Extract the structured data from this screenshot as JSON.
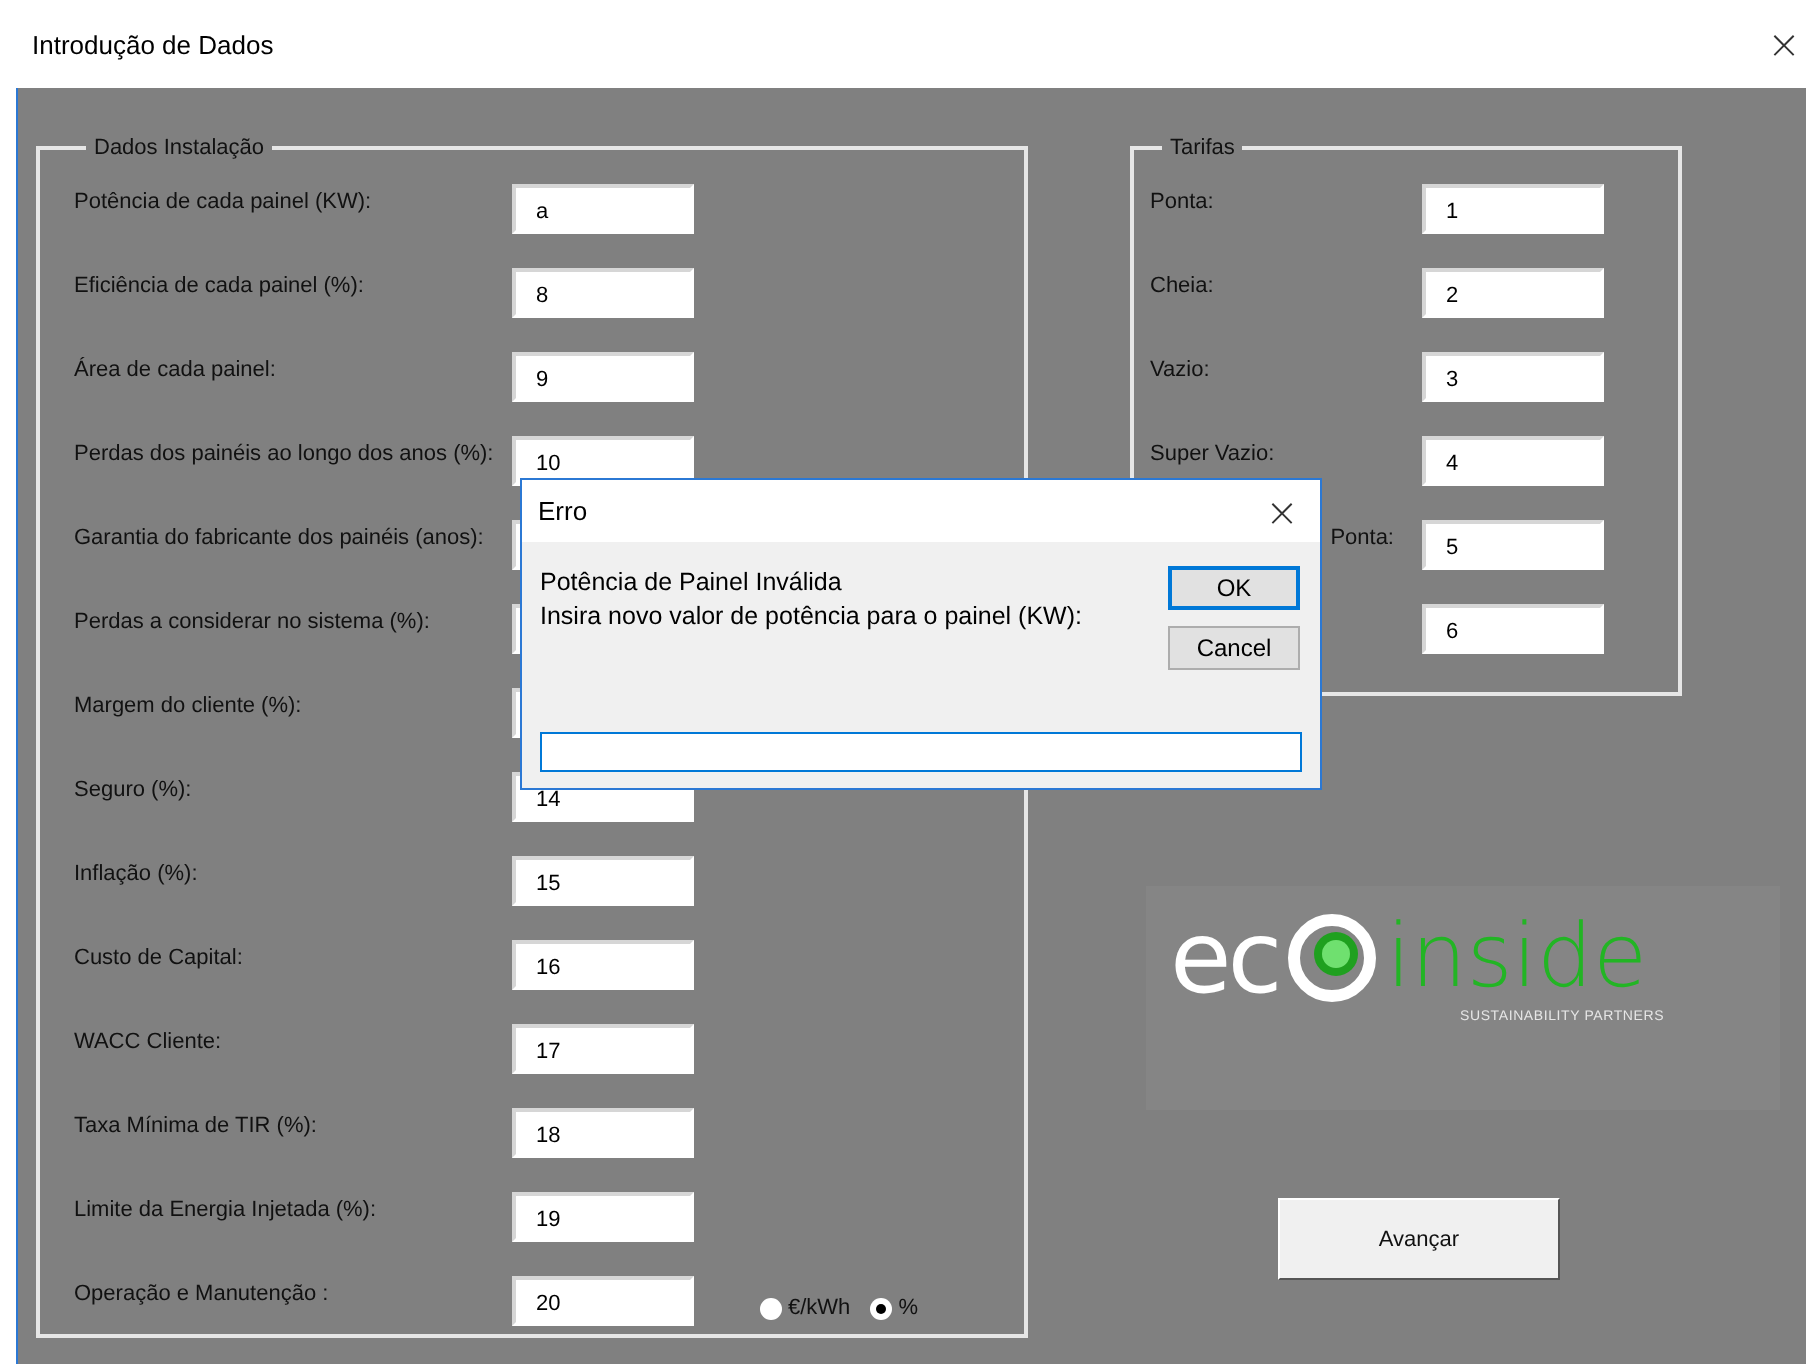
{
  "window": {
    "title": "Introdução de Dados",
    "close": "×"
  },
  "installation": {
    "legend": "Dados Instalação",
    "rows": [
      {
        "label": "Potência de cada painel (KW):",
        "value": "a"
      },
      {
        "label": "Eficiência de cada painel (%):",
        "value": "8"
      },
      {
        "label": "Área de cada painel:",
        "value": "9"
      },
      {
        "label": "Perdas dos painéis ao longo dos anos (%):",
        "value": "10"
      },
      {
        "label": "Garantia do fabricante dos painéis (anos):"
      },
      {
        "label": "Perdas a considerar no sistema (%):"
      },
      {
        "label": "Margem do cliente (%):"
      },
      {
        "label": "Seguro (%):",
        "value": "14"
      },
      {
        "label": "Inflação (%):",
        "value": "15"
      },
      {
        "label": "Custo de Capital:",
        "value": "16"
      },
      {
        "label": "WACC Cliente:",
        "value": "17"
      },
      {
        "label": "Taxa Mínima de TIR (%):",
        "value": "18"
      },
      {
        "label": "Limite da Energia Injetada (%):",
        "value": "19"
      },
      {
        "label": "Operação e Manutenção :",
        "value": "20",
        "units": [
          {
            "label": "€/kWh",
            "selected": false
          },
          {
            "label": "%",
            "selected": true
          }
        ]
      }
    ]
  },
  "tariffs": {
    "legend": "Tarifas",
    "rows": [
      {
        "label": "Ponta:",
        "value": "1"
      },
      {
        "label": "Cheia:",
        "value": "2"
      },
      {
        "label": "Vazio:",
        "value": "3"
      },
      {
        "label": "Super Vazio:",
        "value": "4"
      },
      {
        "label": "Ponta:",
        "value": "5",
        "partly_hidden": true
      },
      {
        "value": "6"
      }
    ]
  },
  "logo": {
    "part_1": "ec",
    "part_2": "inside",
    "tagline": "SUSTAINABILITY PARTNERS"
  },
  "next_button": "Avançar",
  "dialog": {
    "title": "Erro",
    "close": "×",
    "message": [
      "Potência de Painel Inválida",
      "Insira novo valor de potência para o painel (KW):"
    ],
    "buttons": [
      {
        "label": "OK",
        "default": true
      },
      {
        "label": "Cancel",
        "default": false
      }
    ]
  }
}
